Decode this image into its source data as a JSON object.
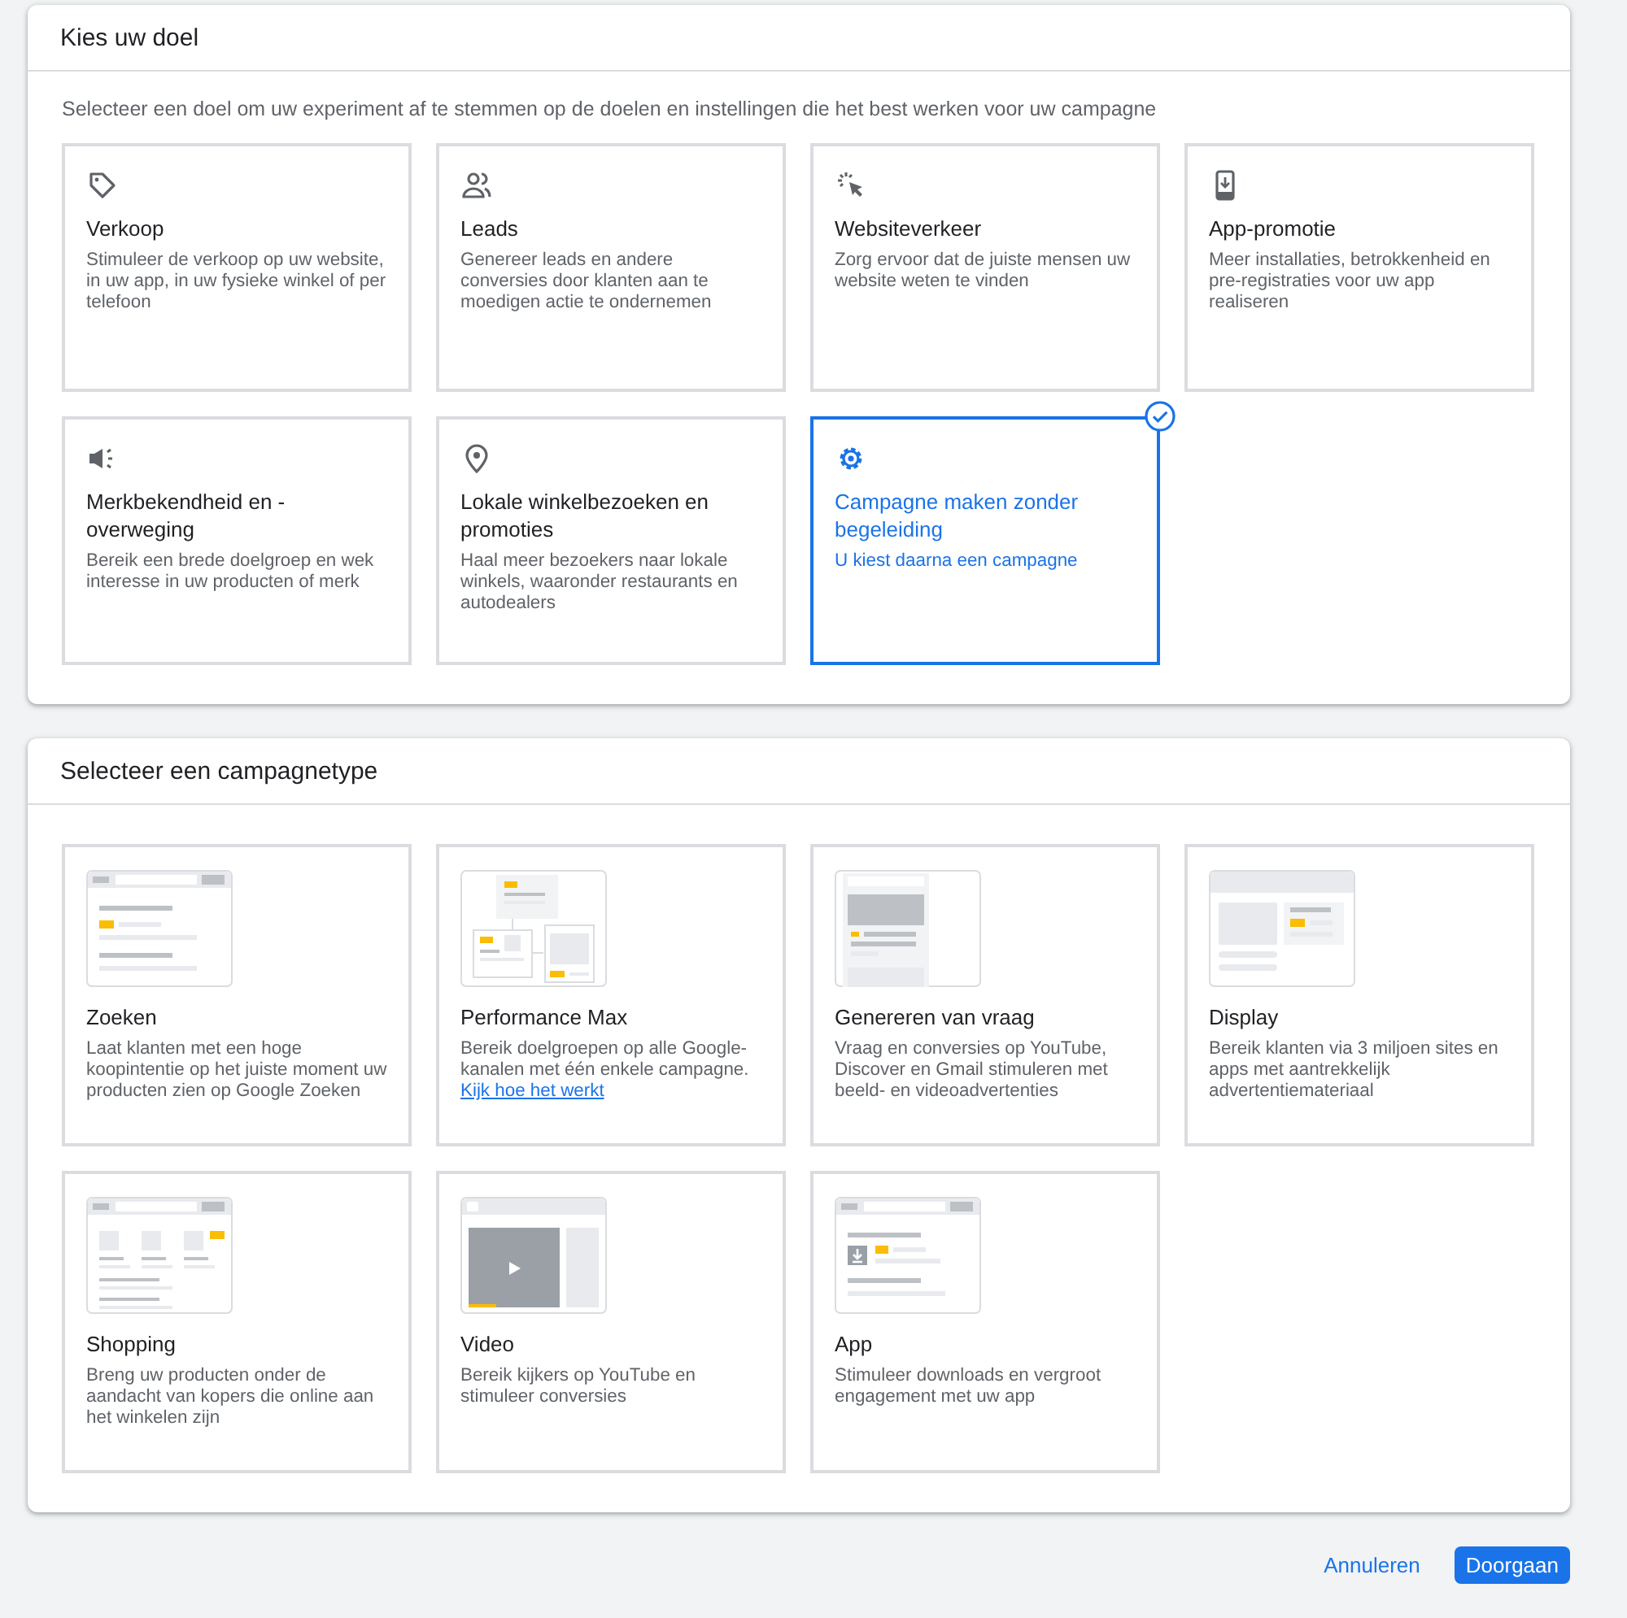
{
  "goal_section": {
    "title": "Kies uw doel",
    "subtitle": "Selecteer een doel om uw experiment af te stemmen op de doelen en instellingen die het best werken voor uw campagne",
    "goals": [
      {
        "kind": "tag",
        "title": "Verkoop",
        "description": "Stimuleer de verkoop op uw website, in uw app, in uw fysieke winkel of per telefoon",
        "selected": false
      },
      {
        "kind": "people",
        "title": "Leads",
        "description": "Genereer leads en andere conversies door klanten aan te moedigen actie te ondernemen",
        "selected": false
      },
      {
        "kind": "cursor",
        "title": "Websiteverkeer",
        "description": "Zorg ervoor dat de juiste mensen uw website weten te vinden",
        "selected": false
      },
      {
        "kind": "phone",
        "title": "App-promotie",
        "description": "Meer installaties, betrokkenheid en pre-registraties voor uw app realiseren",
        "selected": false
      },
      {
        "kind": "megaphone",
        "title": "Merkbekendheid en -overweging",
        "description": "Bereik een brede doelgroep en wek interesse in uw producten of merk",
        "selected": false
      },
      {
        "kind": "pin",
        "title": "Lokale winkelbezoeken en promoties",
        "description": "Haal meer bezoekers naar lokale winkels, waaronder restaurants en autodealers",
        "selected": false
      },
      {
        "kind": "gear",
        "title": "Campagne maken zonder begeleiding",
        "description": "U kiest daarna een campagne",
        "selected": true
      }
    ]
  },
  "campaign_section": {
    "title": "Selecteer een campagnetype",
    "types": [
      {
        "kind": "search",
        "title": "Zoeken",
        "description": "Laat klanten met een hoge koopintentie op het juiste moment uw producten zien op Google Zoeken",
        "selected": false
      },
      {
        "kind": "pmax",
        "title": "Performance Max",
        "description": "Bereik doelgroepen op alle Google-kanalen met één enkele campagne.",
        "link": "Kijk hoe het werkt",
        "selected": false
      },
      {
        "kind": "demand",
        "title": "Genereren van vraag",
        "description": "Vraag en conversies op YouTube, Discover en Gmail stimuleren met beeld- en videoadvertenties",
        "selected": false
      },
      {
        "kind": "display",
        "title": "Display",
        "description": "Bereik klanten via 3 miljoen sites en apps met aantrekkelijk advertentiemateriaal",
        "selected": false
      },
      {
        "kind": "shopping",
        "title": "Shopping",
        "description": "Breng uw producten onder de aandacht van kopers die online aan het winkelen zijn",
        "selected": false
      },
      {
        "kind": "video",
        "title": "Video",
        "description": "Bereik kijkers op YouTube en stimuleer conversies",
        "selected": false
      },
      {
        "kind": "app",
        "title": "App",
        "description": "Stimuleer downloads en vergroot engagement met uw app",
        "selected": false
      }
    ]
  },
  "actions": {
    "cancel": "Annuleren",
    "continue": "Doorgaan"
  }
}
